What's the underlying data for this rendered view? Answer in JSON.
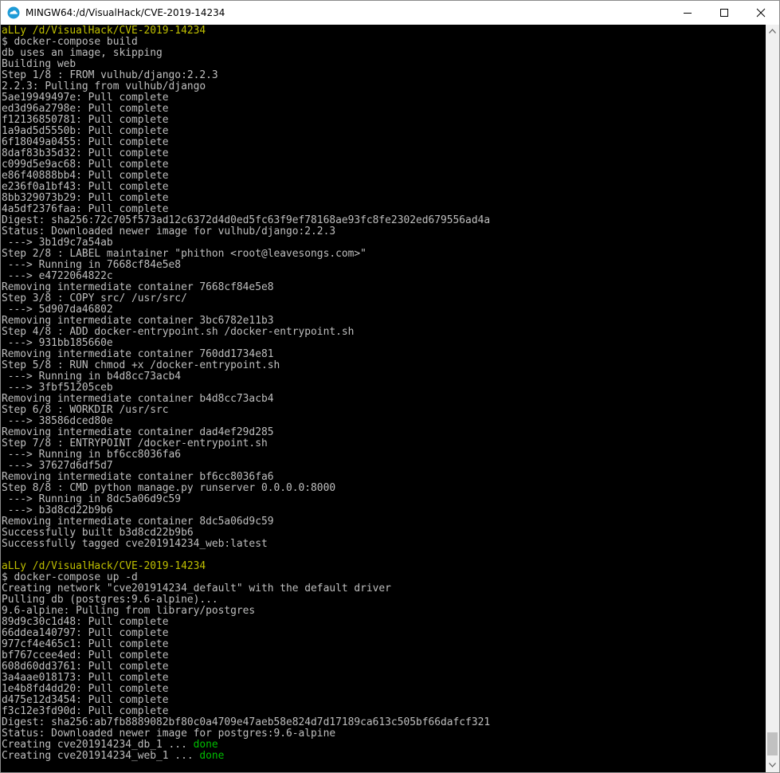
{
  "window": {
    "title": "MINGW64:/d/VisualHack/CVE-2019-14234"
  },
  "icons": {
    "app": "mintty-icon",
    "minimize": "minimize-icon",
    "maximize": "maximize-icon",
    "close": "close-icon"
  },
  "colors": {
    "background": "#000000",
    "text": "#bfbfbf",
    "prompt": "#bfbf00",
    "done": "#00bf00"
  },
  "terminal": {
    "lines": [
      "aLLy /d/VisualHack/CVE-2019-14234",
      "$ docker-compose build",
      "db uses an image, skipping",
      "Building web",
      "Step 1/8 : FROM vulhub/django:2.2.3",
      "2.2.3: Pulling from vulhub/django",
      "5ae19949497e: Pull complete",
      "ed3d96a2798e: Pull complete",
      "f12136850781: Pull complete",
      "1a9ad5d5550b: Pull complete",
      "6f18049a0455: Pull complete",
      "8daf83b35d32: Pull complete",
      "c099d5e9ac68: Pull complete",
      "e86f40888bb4: Pull complete",
      "e236f0a1bf43: Pull complete",
      "8bb329073b29: Pull complete",
      "4a5df2376faa: Pull complete",
      "Digest: sha256:72c705f573ad12c6372d4d0ed5fc63f9ef78168ae93fc8fe2302ed679556ad4a",
      "Status: Downloaded newer image for vulhub/django:2.2.3",
      " ---> 3b1d9c7a54ab",
      "Step 2/8 : LABEL maintainer \"phithon <root@leavesongs.com>\"",
      " ---> Running in 7668cf84e5e8",
      " ---> e4722064822c",
      "Removing intermediate container 7668cf84e5e8",
      "Step 3/8 : COPY src/ /usr/src/",
      " ---> 5d907da46802",
      "Removing intermediate container 3bc6782e11b3",
      "Step 4/8 : ADD docker-entrypoint.sh /docker-entrypoint.sh",
      " ---> 931bb185660e",
      "Removing intermediate container 760dd1734e81",
      "Step 5/8 : RUN chmod +x /docker-entrypoint.sh",
      " ---> Running in b4d8cc73acb4",
      " ---> 3fbf51205ceb",
      "Removing intermediate container b4d8cc73acb4",
      "Step 6/8 : WORKDIR /usr/src",
      " ---> 38586dced80e",
      "Removing intermediate container dad4ef29d285",
      "Step 7/8 : ENTRYPOINT /docker-entrypoint.sh",
      " ---> Running in bf6cc8036fa6",
      " ---> 37627d6df5d7",
      "Removing intermediate container bf6cc8036fa6",
      "Step 8/8 : CMD python manage.py runserver 0.0.0.0:8000",
      " ---> Running in 8dc5a06d9c59",
      " ---> b3d8cd22b9b6",
      "Removing intermediate container 8dc5a06d9c59",
      "Successfully built b3d8cd22b9b6",
      "Successfully tagged cve201914234_web:latest",
      "",
      "aLLy /d/VisualHack/CVE-2019-14234",
      "$ docker-compose up -d",
      "Creating network \"cve201914234_default\" with the default driver",
      "Pulling db (postgres:9.6-alpine)...",
      "9.6-alpine: Pulling from library/postgres",
      "89d9c30c1d48: Pull complete",
      "66ddea140797: Pull complete",
      "977cf4e465c1: Pull complete",
      "bf767ccee4ed: Pull complete",
      "608d60dd3761: Pull complete",
      "3a4aae018173: Pull complete",
      "1e4b8fd4dd20: Pull complete",
      "d475e12d3454: Pull complete",
      "f3c12e3fd90d: Pull complete",
      "Digest: sha256:ab7fb8889082bf80c0a4709e47aeb58e824d7d17189ca613c505bf66dafcf321",
      "Status: Downloaded newer image for postgres:9.6-alpine",
      "Creating cve201914234_db_1 ... ",
      "Creating cve201914234_web_1 ... "
    ],
    "prompt_lines": [
      0,
      48
    ],
    "done_label": "done"
  }
}
